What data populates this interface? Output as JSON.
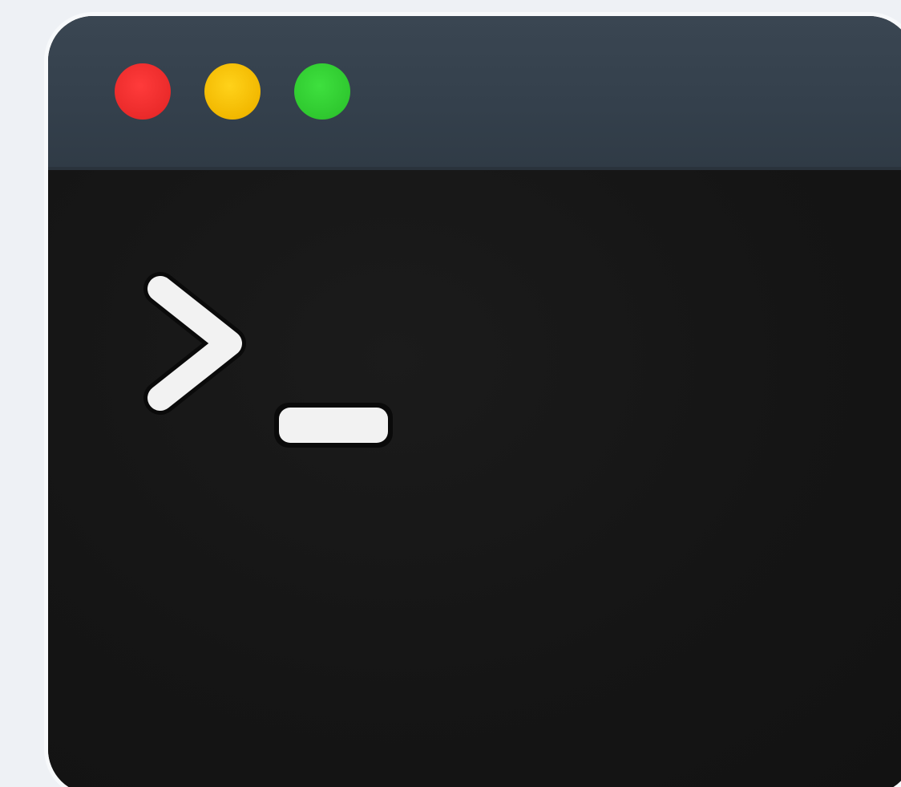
{
  "window": {
    "controls": [
      {
        "name": "close",
        "color": "#ea2a2a"
      },
      {
        "name": "minimize",
        "color": "#f2b800"
      },
      {
        "name": "zoom",
        "color": "#2fc82f"
      }
    ],
    "title_bar_color": "#36424e",
    "body_color": "#151515"
  },
  "terminal": {
    "prompt_icon": "prompt-chevron-icon",
    "cursor_icon": "cursor-underscore-icon",
    "glyph_color": "#f2f2f2"
  }
}
